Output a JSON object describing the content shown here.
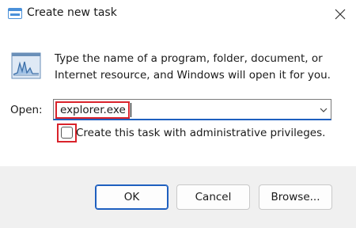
{
  "window": {
    "title": "Create new task",
    "title_icon": "run-dialog-icon",
    "close_icon": "close-icon"
  },
  "body": {
    "app_icon": "task-manager-icon",
    "description_line1": "Type the name of a program, folder, document, or",
    "description_line2": "Internet resource, and Windows will open it for you.",
    "open_label": "Open:",
    "open_value": "explorer.exe",
    "dropdown_icon": "chevron-down-icon",
    "admin_checkbox_label": "Create this task with administrative privileges.",
    "admin_checked": false
  },
  "buttons": {
    "ok": "OK",
    "cancel": "Cancel",
    "browse": "Browse..."
  },
  "colors": {
    "highlight": "#d9232b",
    "accent": "#1e5fbf",
    "footer_bg": "#f0f0f0"
  }
}
